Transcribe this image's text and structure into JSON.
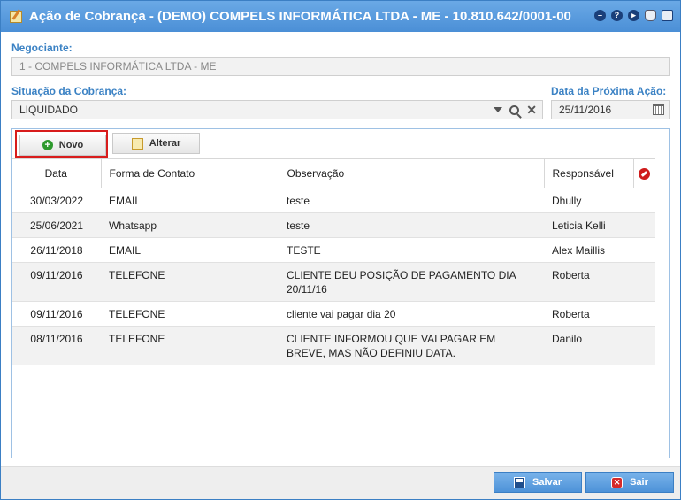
{
  "window": {
    "title": "Ação de Cobrança - (DEMO) COMPELS INFORMÁTICA LTDA - ME - 10.810.642/0001-00",
    "icons": [
      "edit-icon",
      "minimize-icon",
      "help-icon",
      "play-icon",
      "notification-icon",
      "calendar-icon"
    ]
  },
  "form": {
    "negociante_label": "Negociante:",
    "negociante_value": "1 - COMPELS INFORMÁTICA LTDA - ME",
    "situacao_label": "Situação da Cobrança:",
    "situacao_value": "LIQUIDADO",
    "proxima_acao_label": "Data da Próxima Ação:",
    "proxima_acao_value": "25/11/2016"
  },
  "toolbar": {
    "novo_label": "Novo",
    "alterar_label": "Alterar"
  },
  "table": {
    "columns": [
      "Data",
      "Forma de Contato",
      "Observação",
      "Responsável"
    ],
    "rows": [
      {
        "data": "30/03/2022",
        "forma": "EMAIL",
        "obs": "teste",
        "resp": "Dhully"
      },
      {
        "data": "25/06/2021",
        "forma": "Whatsapp",
        "obs": "teste",
        "resp": "Leticia Kelli"
      },
      {
        "data": "26/11/2018",
        "forma": "EMAIL",
        "obs": "TESTE",
        "resp": "Alex Maillis"
      },
      {
        "data": "09/11/2016",
        "forma": "TELEFONE",
        "obs": "CLIENTE DEU POSIÇÃO DE PAGAMENTO DIA 20/11/16",
        "resp": "Roberta"
      },
      {
        "data": "09/11/2016",
        "forma": "TELEFONE",
        "obs": "cliente vai pagar dia 20",
        "resp": "Roberta"
      },
      {
        "data": "08/11/2016",
        "forma": "TELEFONE",
        "obs": "CLIENTE INFORMOU QUE VAI PAGAR EM BREVE, MAS NÃO DEFINIU DATA.",
        "resp": "Danilo"
      }
    ]
  },
  "footer": {
    "salvar_label": "Salvar",
    "sair_label": "Sair"
  },
  "colors": {
    "titlebar": "#4b8fd6",
    "label": "#3b82c4",
    "highlight": "#d81c1c"
  }
}
